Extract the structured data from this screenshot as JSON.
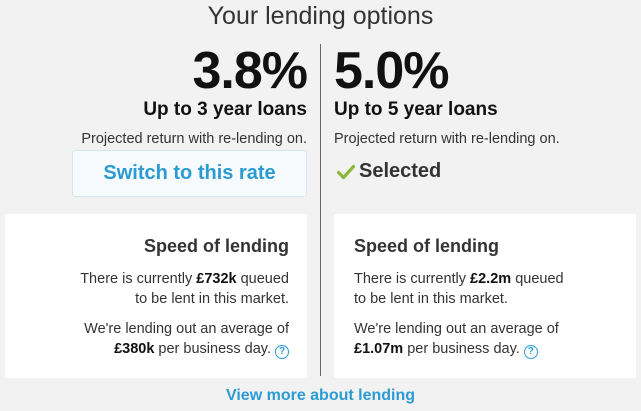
{
  "page_title": "Your lending options",
  "options": [
    {
      "rate": "3.8%",
      "term": "Up to 3 year loans",
      "projected": "Projected return with re-lending on.",
      "action_label": "Switch to this rate",
      "speed": {
        "title": "Speed of lending",
        "queued_prefix": "There is currently ",
        "queued_amount": "£732k",
        "queued_suffix": " queued",
        "queued_line2": "to be lent in this market.",
        "avg_prefix": "We're lending out an average of",
        "avg_amount": "£380k",
        "avg_suffix": " per business day."
      }
    },
    {
      "rate": "5.0%",
      "term": "Up to 5 year loans",
      "projected": "Projected return with re-lending on.",
      "status_label": "Selected",
      "speed": {
        "title": "Speed of lending",
        "queued_prefix": "There is currently ",
        "queued_amount": "£2.2m",
        "queued_suffix": " queued",
        "queued_line2": "to be lent in this market.",
        "avg_prefix": "We're lending out an average of",
        "avg_amount": "£1.07m",
        "avg_suffix": " per business day."
      }
    }
  ],
  "help_icon_glyph": "?",
  "view_more_label": "View more about lending",
  "colors": {
    "accent": "#2b9bd3",
    "check": "#8bb63a",
    "background": "#f2f2f2"
  }
}
